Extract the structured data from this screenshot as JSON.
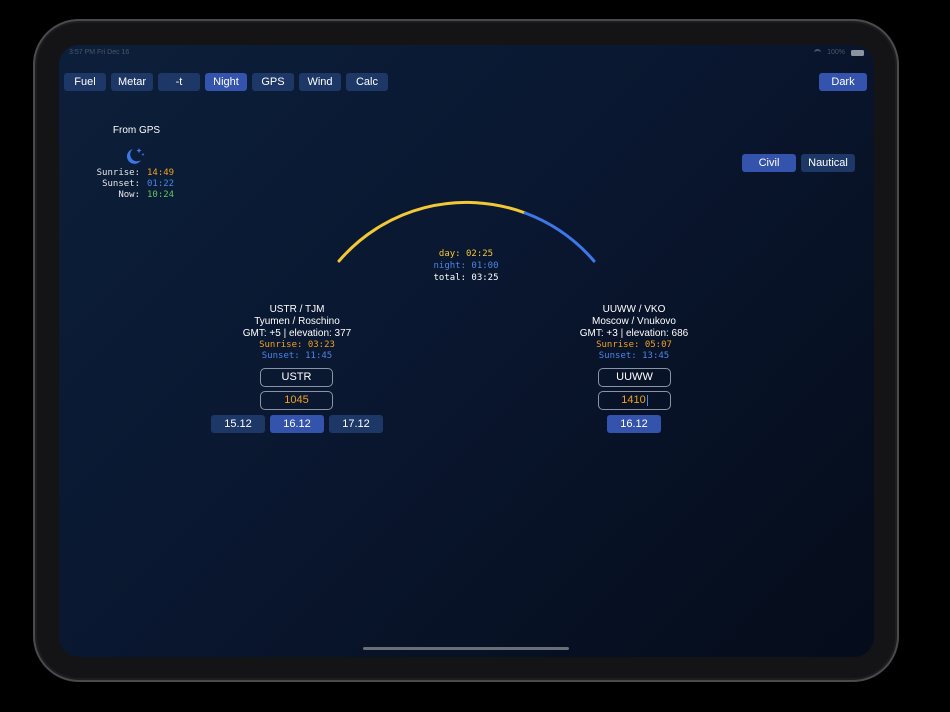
{
  "status_bar": {
    "time": "3:57 PM",
    "date": "Fri Dec 16",
    "battery": "100%"
  },
  "toolbar": {
    "tabs": [
      {
        "label": "Fuel",
        "active": false
      },
      {
        "label": "Metar",
        "active": false
      },
      {
        "label": "-t",
        "active": false
      },
      {
        "label": "Night",
        "active": true
      },
      {
        "label": "GPS",
        "active": false
      },
      {
        "label": "Wind",
        "active": false
      },
      {
        "label": "Calc",
        "active": false
      }
    ],
    "theme_button": "Dark"
  },
  "gps": {
    "title": "From GPS",
    "sunrise_label": "Sunrise:",
    "sunrise": "14:49",
    "sunset_label": "Sunset:",
    "sunset": "01:22",
    "now_label": "Now:",
    "now": "10:24"
  },
  "twilight": {
    "options": [
      "Civil",
      "Nautical"
    ],
    "selected": "Civil"
  },
  "durations": {
    "day": "day: 02:25",
    "night": "night: 01:00",
    "total": "total: 03:25"
  },
  "arc": {
    "day_fraction": 0.7073,
    "day_color": "#f2c836",
    "night_color": "#3d78e8"
  },
  "departure": {
    "code": "USTR / TJM",
    "name": "Tyumen / Roschino",
    "info": "GMT: +5  |  elevation: 377",
    "sunrise": "Sunrise: 03:23",
    "sunset": "Sunset: 11:45",
    "icao": "USTR",
    "time": "1045",
    "dates": [
      {
        "label": "15.12",
        "active": false
      },
      {
        "label": "16.12",
        "active": true
      },
      {
        "label": "17.12",
        "active": false
      }
    ]
  },
  "arrival": {
    "code": "UUWW / VKO",
    "name": "Moscow / Vnukovo",
    "info": "GMT: +3  |  elevation: 686",
    "sunrise": "Sunrise: 05:07",
    "sunset": "Sunset: 13:45",
    "icao": "UUWW",
    "time": "1410",
    "dates": [
      {
        "label": "16.12",
        "active": true
      }
    ]
  }
}
